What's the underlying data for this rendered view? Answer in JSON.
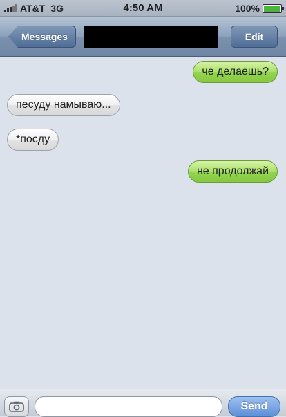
{
  "status_bar": {
    "carrier": "AT&T",
    "network": "3G",
    "time": "4:50 AM",
    "battery": "100%",
    "battery_level": 1.0,
    "battery_color": "#4db33d",
    "signal_icon": "signal-bars-icon"
  },
  "nav": {
    "back_label": "Messages",
    "edit_label": "Edit",
    "title_redacted": true
  },
  "messages": [
    {
      "direction": "outgoing",
      "text": "че делаешь?"
    },
    {
      "direction": "incoming",
      "text": "песуду намываю..."
    },
    {
      "direction": "incoming",
      "text": "*посду"
    },
    {
      "direction": "outgoing",
      "text": "не продолжай"
    }
  ],
  "input_bar": {
    "camera_icon": "camera-icon",
    "text_value": "",
    "send_label": "Send"
  },
  "colors": {
    "outgoing_bubble": "#94d452",
    "incoming_bubble": "#e3e3e3",
    "background": "#dbe2ec",
    "nav_bar": "#7c92ae"
  }
}
